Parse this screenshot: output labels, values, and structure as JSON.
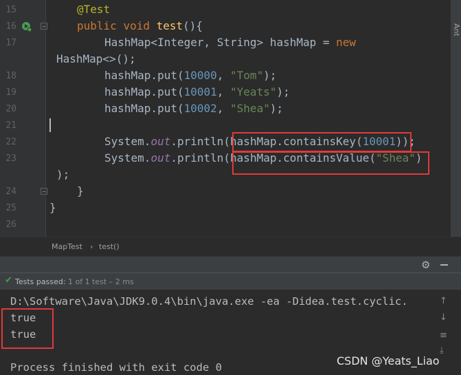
{
  "editor": {
    "line_numbers": [
      "15",
      "16",
      "17",
      "",
      "18",
      "19",
      "20",
      "21",
      "22",
      "23",
      "",
      "24",
      "25",
      "26"
    ],
    "code": {
      "l15_annotation": "@Test",
      "l16_public": "public",
      "l16_void": "void",
      "l16_name": "test",
      "l16_rest": "(){",
      "l17_a": "HashMap<Integer, String> hashMap = ",
      "l17_new": "new",
      "l17_b": "HashMap<>();",
      "put1_a": "hashMap.put(",
      "put1_num": "10000",
      "put1_b": ", ",
      "put1_str": "\"Tom\"",
      "put1_c": ");",
      "put2_a": "hashMap.put(",
      "put2_num": "10001",
      "put2_b": ", ",
      "put2_str": "\"Yeats\"",
      "put2_c": ");",
      "put3_a": "hashMap.put(",
      "put3_num": "10002",
      "put3_b": ", ",
      "put3_str": "\"Shea\"",
      "put3_c": ");",
      "p1_a": "System.",
      "p1_out": "out",
      "p1_b": ".println(hashMap.containsKey(",
      "p1_num": "10001",
      "p1_c": "));",
      "p2_a": "System.",
      "p2_out": "out",
      "p2_b": ".println(hashMap.containsValue(",
      "p2_str": "\"Shea\"",
      "p2_c": ")",
      "p2_d": ");",
      "close_method": "}",
      "close_class": "}"
    },
    "right_strip_label": "Ant"
  },
  "breadcrumb": {
    "class_name": "MapTest",
    "separator": "›",
    "method_name": "test()"
  },
  "run_panel": {
    "tests_passed_label": "Tests passed:",
    "tests_passed_detail": "1 of 1 test – 2 ms",
    "console_lines": [
      "D:\\Software\\Java\\JDK9.0.4\\bin\\java.exe -ea -Didea.test.cyclic.",
      "true",
      "true",
      "",
      "Process finished with exit code 0"
    ],
    "watermark": "CSDN @Yeats_Liao"
  },
  "icons": {
    "run": "run-gutter-icon",
    "gear": "gear-icon",
    "hide": "minimize-icon",
    "check": "check-icon"
  },
  "colors": {
    "background": "#2b2b2b",
    "keyword": "#cc7832",
    "string": "#6a8759",
    "number": "#6897bb",
    "highlight_box": "#e03a3a",
    "passed": "#499c54"
  }
}
